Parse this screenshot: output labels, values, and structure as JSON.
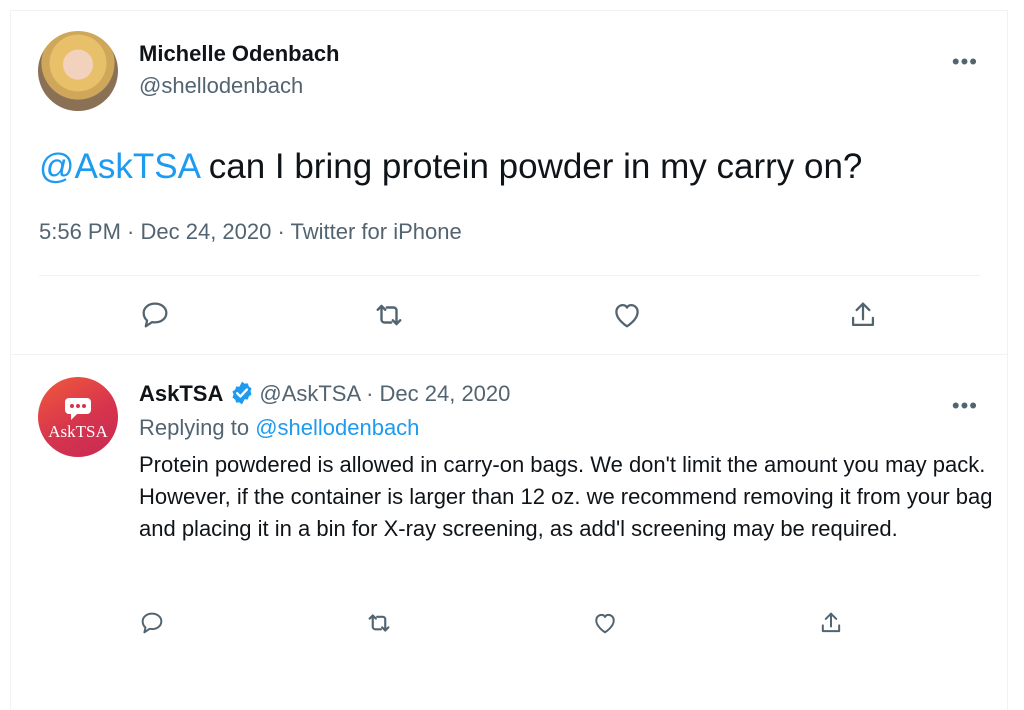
{
  "main_tweet": {
    "author_name": "Michelle Odenbach",
    "author_handle": "@shellodenbach",
    "more_label": "•••",
    "mention": "@AskTSA",
    "body": " can I bring protein powder in my carry on?",
    "time": "5:56 PM",
    "date": "Dec 24, 2020",
    "source": "Twitter for iPhone",
    "separator": " · "
  },
  "reply_tweet": {
    "avatar_label": "AskTSA",
    "author_name": "AskTSA",
    "author_handle": "@AskTSA",
    "date": "Dec 24, 2020",
    "separator": " · ",
    "more_label": "•••",
    "replying_prefix": "Replying to ",
    "replying_to": "@shellodenbach",
    "body": "Protein powdered is allowed in carry-on bags. We don't limit the amount you may pack. However, if the container is larger than 12 oz. we recommend removing it from your bag and placing it in a bin for X-ray screening, as add'l screening may be required."
  },
  "icons": {
    "reply": "reply-icon",
    "retweet": "retweet-icon",
    "like": "heart-icon",
    "share": "share-icon",
    "verified": "verified-badge-icon"
  },
  "colors": {
    "link": "#1d9bf0",
    "secondary_text": "#536471",
    "divider": "#eff3f4"
  }
}
